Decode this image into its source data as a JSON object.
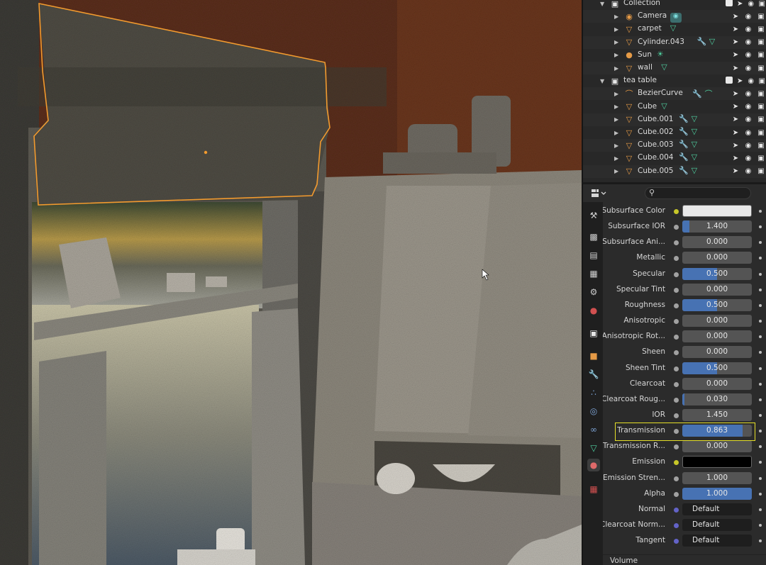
{
  "outliner": {
    "rows": [
      {
        "name": "Collection",
        "kind": "collection",
        "level": 0,
        "icon": "collection-icon",
        "extra": ""
      },
      {
        "name": "Camera",
        "kind": "object",
        "level": 1,
        "icon": "camera-icon",
        "extra": "camera-data-icon"
      },
      {
        "name": "carpet",
        "kind": "object",
        "level": 1,
        "icon": "mesh-icon",
        "extra": "mesh-data-icon"
      },
      {
        "name": "Cylinder.043",
        "kind": "object",
        "level": 1,
        "icon": "mesh-icon",
        "extra": "modifier-mesh-icons"
      },
      {
        "name": "Sun",
        "kind": "object",
        "level": 1,
        "icon": "light-icon",
        "extra": "sun-data-icon"
      },
      {
        "name": "wall",
        "kind": "object",
        "level": 1,
        "icon": "mesh-icon",
        "extra": "mesh-data-icon"
      },
      {
        "name": "tea table",
        "kind": "collection",
        "level": 0,
        "icon": "collection-icon",
        "extra": ""
      },
      {
        "name": "BezierCurve",
        "kind": "object",
        "level": 1,
        "icon": "curve-icon",
        "extra": "modifier-curve-icons"
      },
      {
        "name": "Cube",
        "kind": "object",
        "level": 1,
        "icon": "mesh-icon",
        "extra": "mesh-data-icon"
      },
      {
        "name": "Cube.001",
        "kind": "object",
        "level": 1,
        "icon": "mesh-icon",
        "extra": "modifier-mesh-icons"
      },
      {
        "name": "Cube.002",
        "kind": "object",
        "level": 1,
        "icon": "mesh-icon",
        "extra": "modifier-mesh-icons"
      },
      {
        "name": "Cube.003",
        "kind": "object",
        "level": 1,
        "icon": "mesh-icon",
        "extra": "modifier-mesh-icons"
      },
      {
        "name": "Cube.004",
        "kind": "object",
        "level": 1,
        "icon": "mesh-icon",
        "extra": "modifier-mesh-icons"
      },
      {
        "name": "Cube.005",
        "kind": "object",
        "level": 1,
        "icon": "mesh-icon",
        "extra": "modifier-mesh-icons"
      }
    ]
  },
  "properties": {
    "search_placeholder": "",
    "rows": [
      {
        "label": "Subsurface Color",
        "type": "color",
        "socket": "yellow",
        "value": "",
        "color": "#e8e8e8"
      },
      {
        "label": "Subsurface IOR",
        "type": "slider",
        "socket": "grey",
        "value": "1.400",
        "fill": 0.1
      },
      {
        "label": "Subsurface Ani...",
        "type": "slider",
        "socket": "grey",
        "value": "0.000",
        "fill": 0
      },
      {
        "label": "Metallic",
        "type": "slider",
        "socket": "grey",
        "value": "0.000",
        "fill": 0
      },
      {
        "label": "Specular",
        "type": "slider",
        "socket": "grey",
        "value": "0.500",
        "fill": 0.5
      },
      {
        "label": "Specular Tint",
        "type": "slider",
        "socket": "grey",
        "value": "0.000",
        "fill": 0
      },
      {
        "label": "Roughness",
        "type": "slider",
        "socket": "grey",
        "value": "0.500",
        "fill": 0.5
      },
      {
        "label": "Anisotropic",
        "type": "slider",
        "socket": "grey",
        "value": "0.000",
        "fill": 0
      },
      {
        "label": "Anisotropic Rot...",
        "type": "slider",
        "socket": "grey",
        "value": "0.000",
        "fill": 0
      },
      {
        "label": "Sheen",
        "type": "slider",
        "socket": "grey",
        "value": "0.000",
        "fill": 0
      },
      {
        "label": "Sheen Tint",
        "type": "slider",
        "socket": "grey",
        "value": "0.500",
        "fill": 0.5
      },
      {
        "label": "Clearcoat",
        "type": "slider",
        "socket": "grey",
        "value": "0.000",
        "fill": 0
      },
      {
        "label": "Clearcoat Roug...",
        "type": "slider",
        "socket": "grey",
        "value": "0.030",
        "fill": 0.03
      },
      {
        "label": "IOR",
        "type": "slider",
        "socket": "grey",
        "value": "1.450",
        "fill": 0
      },
      {
        "label": "Transmission",
        "type": "slider",
        "socket": "grey",
        "value": "0.863",
        "fill": 0.863
      },
      {
        "label": "Transmission R...",
        "type": "slider",
        "socket": "grey",
        "value": "0.000",
        "fill": 0
      },
      {
        "label": "Emission",
        "type": "color",
        "socket": "yellow",
        "value": "",
        "color": "#000000"
      },
      {
        "label": "Emission Stren...",
        "type": "slider",
        "socket": "grey",
        "value": "1.000",
        "fill": 0
      },
      {
        "label": "Alpha",
        "type": "slider",
        "socket": "grey",
        "value": "1.000",
        "fill": 1.0
      },
      {
        "label": "Normal",
        "type": "vector",
        "socket": "blue",
        "value": "Default"
      },
      {
        "label": "Clearcoat Norm...",
        "type": "vector",
        "socket": "blue",
        "value": "Default"
      },
      {
        "label": "Tangent",
        "type": "vector",
        "socket": "blue",
        "value": "Default"
      }
    ],
    "volume_label": "Volume",
    "tabs": [
      "tool-icon",
      "render-icon",
      "output-icon",
      "view-layer-icon",
      "scene-icon",
      "world-icon",
      "collection-icon",
      "object-icon",
      "modifier-icon",
      "particles-icon",
      "physics-icon",
      "constraints-icon",
      "object-data-icon",
      "material-icon",
      "texture-icon"
    ]
  },
  "colors": {
    "accent": "#4772b3",
    "selection_outline": "#f29a2e",
    "highlight_box": "#e6e028"
  }
}
